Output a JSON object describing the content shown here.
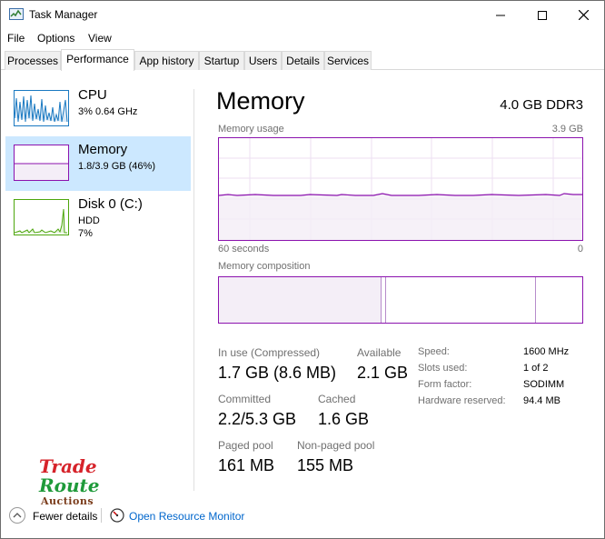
{
  "window": {
    "title": "Task Manager",
    "controls": [
      "minimize",
      "maximize",
      "close"
    ]
  },
  "menu": [
    "File",
    "Options",
    "View"
  ],
  "tabs": [
    "Processes",
    "Performance",
    "App history",
    "Startup",
    "Users",
    "Details",
    "Services"
  ],
  "active_tab": "Performance",
  "resources": [
    {
      "title": "CPU",
      "line1": "3%  0.64 GHz",
      "line2": "",
      "color": "#1a79c1"
    },
    {
      "title": "Memory",
      "line1": "1.8/3.9 GB (46%)",
      "line2": "",
      "color": "#8b12ae",
      "selected": true
    },
    {
      "title": "Disk 0 (C:)",
      "line1": "HDD",
      "line2": "7%",
      "color": "#4da60c"
    }
  ],
  "detail": {
    "title": "Memory",
    "type": "4.0 GB DDR3",
    "usage_label": "Memory usage",
    "usage_max": "3.9 GB",
    "time_left": "60 seconds",
    "time_right": "0",
    "composition_label": "Memory composition",
    "usage_fraction": 0.46
  },
  "stats": {
    "in_use_label": "In use (Compressed)",
    "in_use_value": "1.7 GB (8.6 MB)",
    "available_label": "Available",
    "available_value": "2.1 GB",
    "committed_label": "Committed",
    "committed_value": "2.2/5.3 GB",
    "cached_label": "Cached",
    "cached_value": "1.6 GB",
    "paged_label": "Paged pool",
    "paged_value": "161 MB",
    "nonpaged_label": "Non-paged pool",
    "nonpaged_value": "155 MB"
  },
  "specs": [
    {
      "label": "Speed:",
      "value": "1600 MHz"
    },
    {
      "label": "Slots used:",
      "value": "1 of 2"
    },
    {
      "label": "Form factor:",
      "value": "SODIMM"
    },
    {
      "label": "Hardware reserved:",
      "value": "94.4 MB"
    }
  ],
  "watermark": [
    "Trade",
    "Route",
    "Auctions"
  ],
  "footer": {
    "fewer_details": "Fewer details",
    "open_monitor": "Open Resource Monitor"
  },
  "colors": {
    "memory": "#8b12ae",
    "cpu": "#1a79c1",
    "disk": "#4da60c",
    "selected_bg": "#cce8ff"
  }
}
